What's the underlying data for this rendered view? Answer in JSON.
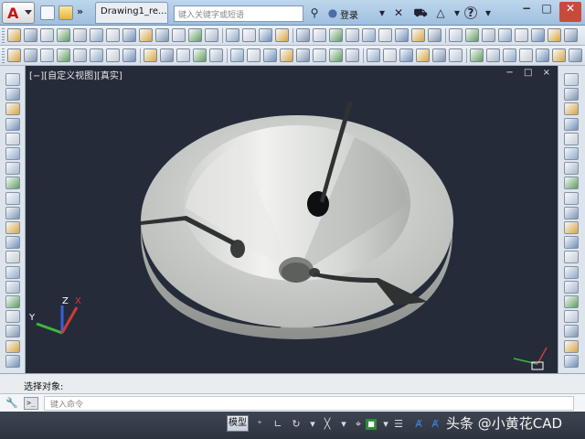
{
  "titlebar": {
    "app_letter": "A",
    "doc_tab": "Drawing1_re...",
    "search_placeholder": "键入关键字或短语",
    "login_label": "登录",
    "help_label": "?"
  },
  "viewport": {
    "label": "[−][自定义视图][真实]",
    "controls": "− □ ×",
    "ucs_axes": [
      "X",
      "Y",
      "Z"
    ]
  },
  "command": {
    "history_text": "选择对象:",
    "input_placeholder": "键入命令",
    "prompt_icon": ">_"
  },
  "statusbar": {
    "model_label": "模型"
  },
  "watermark": "头条 @小黄花CAD",
  "colors": {
    "viewport_bg": "#252b39",
    "model_surface": "#c9cbc9",
    "model_shadow": "#8f9290"
  }
}
